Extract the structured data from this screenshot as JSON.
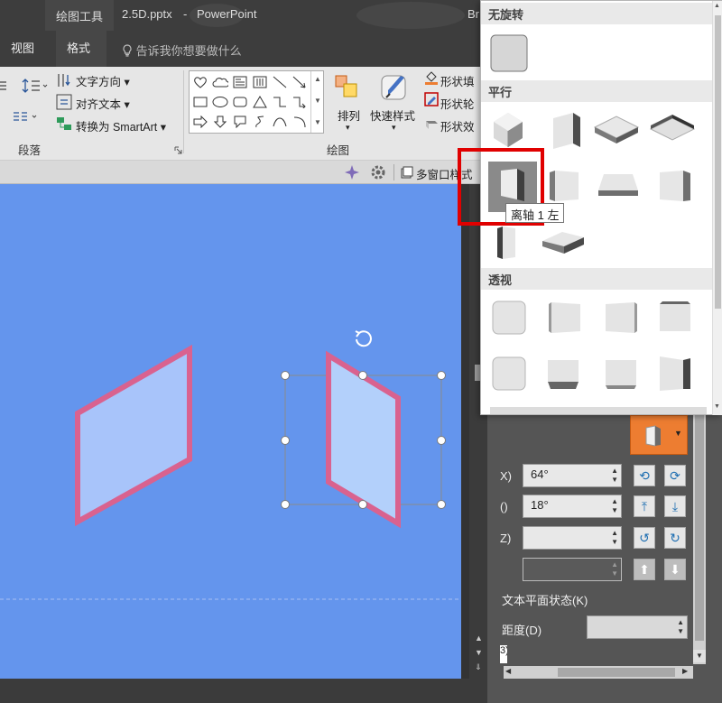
{
  "titlebar": {
    "context_tab": "绘图工具",
    "filename": "2.5D.pptx",
    "separator": "-",
    "app": "PowerPoint",
    "user_partial": "Br"
  },
  "tabs": {
    "items": [
      "视图",
      "格式"
    ],
    "active": "格式",
    "tell_me": "告诉我你想要做什么"
  },
  "ribbon": {
    "text_direction": "文字方向",
    "align_text": "对齐文本",
    "convert_smartart": "转换为 SmartArt",
    "paragraph_group": "段落",
    "drawing_group": "绘图",
    "arrange": "排列",
    "quick_styles": "快速样式",
    "shape_fill": "形状填",
    "shape_outline": "形状轮",
    "shape_effects": "形状效",
    "dropdown_arrow": "▾"
  },
  "secondary_bar": {
    "multi_window": "多窗口样式"
  },
  "gallery": {
    "sections": [
      "无旋转",
      "平行",
      "透视"
    ],
    "tooltip": "离轴 1 左"
  },
  "format_pane": {
    "x_rotation_label": "X)",
    "y_rotation_label": "()",
    "z_rotation_label": "Z)",
    "x_rotation_value": "64°",
    "y_rotation_value": "18°",
    "z_rotation_value": "",
    "perspective_value": "",
    "text_flat_label": "文本平面状态(K)",
    "distance_label": "距度(D)",
    "distance_value": "",
    "partial_label": "3)"
  },
  "colors": {
    "canvas": "#6495ED",
    "shape_fill": "#A8C4FA",
    "shape_outline": "#D9628F",
    "accent_orange": "#ED7D31",
    "highlight_red": "#E00000"
  }
}
